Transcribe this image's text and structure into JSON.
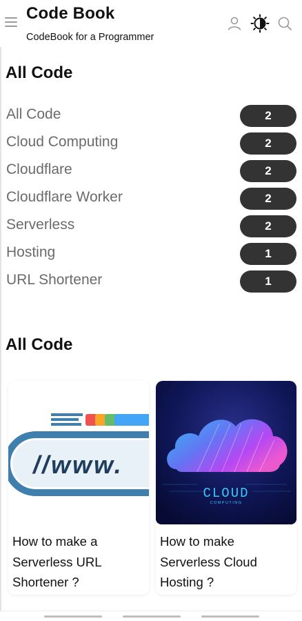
{
  "header": {
    "title": "Code Book",
    "subtitle": "CodeBook for a Programmer",
    "icons": [
      "menu-icon",
      "user-icon",
      "theme-toggle-icon",
      "search-icon"
    ]
  },
  "labels_section": {
    "title": "All Code",
    "items": [
      {
        "label": "All Code",
        "count": "2"
      },
      {
        "label": "Cloud Computing",
        "count": "2"
      },
      {
        "label": "Cloudflare",
        "count": "2"
      },
      {
        "label": "Cloudflare Worker",
        "count": "2"
      },
      {
        "label": "Serverless",
        "count": "2"
      },
      {
        "label": "Hosting",
        "count": "1"
      },
      {
        "label": "URL Shortener",
        "count": "1"
      }
    ]
  },
  "posts_section": {
    "title": "All Code",
    "posts": [
      {
        "title": "How to make a Serverless URL Shortener ?",
        "thumb_text": "//www."
      },
      {
        "title": "How to make Serverless Cloud Hosting ?",
        "thumb_text": "CLOUD",
        "thumb_subtext": "COMPUTING"
      }
    ]
  },
  "colors": {
    "badge": "#333333",
    "label_text": "#6b6b6b",
    "url_frame": "#3f7fae",
    "url_text": "#1f3d5c",
    "cloud_bg": "#0b1240"
  }
}
